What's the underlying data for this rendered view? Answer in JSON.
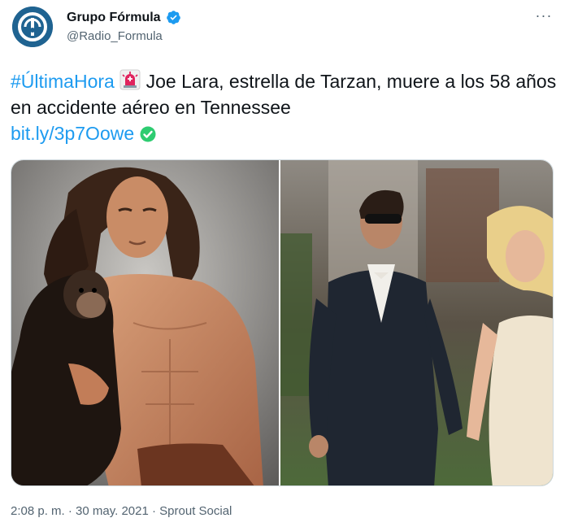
{
  "author": {
    "display_name": "Grupo Fórmula",
    "handle": "@Radio_Formula",
    "avatar_icon": "grupo-formula-logo-icon",
    "verified_icon": "verified-badge-icon"
  },
  "menu": {
    "more_label": "···"
  },
  "tweet": {
    "hashtag": "#ÚltimaHora",
    "siren_icon": "rotating-light-emoji",
    "body": " Joe Lara, estrella de Tarzan, muere a los 58 años en accidente aéreo en Tennessee",
    "link": "bit.ly/3p7Oowe",
    "check_icon": "green-check-emoji"
  },
  "media": {
    "left_photo": "tarzan-with-chimpanzee-photo",
    "right_photo": "man-in-suit-with-woman-photo"
  },
  "footer": {
    "time": "2:08 p. m.",
    "separator1": " · ",
    "date": "30 may. 2021",
    "separator2": " · ",
    "source": "Sprout Social"
  },
  "colors": {
    "link": "#1d9bf0",
    "secondary_text": "#536471",
    "verified": "#1d9bf0"
  }
}
